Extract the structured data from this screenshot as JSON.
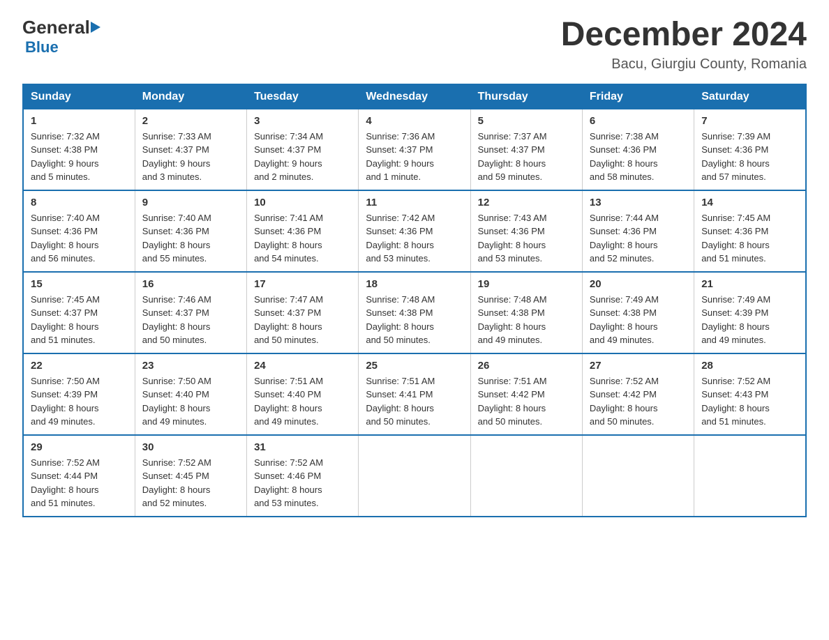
{
  "header": {
    "logo_general": "General",
    "logo_blue": "Blue",
    "title": "December 2024",
    "location": "Bacu, Giurgiu County, Romania"
  },
  "calendar": {
    "days_of_week": [
      "Sunday",
      "Monday",
      "Tuesday",
      "Wednesday",
      "Thursday",
      "Friday",
      "Saturday"
    ],
    "weeks": [
      [
        {
          "day": "1",
          "sunrise": "7:32 AM",
          "sunset": "4:38 PM",
          "daylight": "9 hours and 5 minutes."
        },
        {
          "day": "2",
          "sunrise": "7:33 AM",
          "sunset": "4:37 PM",
          "daylight": "9 hours and 3 minutes."
        },
        {
          "day": "3",
          "sunrise": "7:34 AM",
          "sunset": "4:37 PM",
          "daylight": "9 hours and 2 minutes."
        },
        {
          "day": "4",
          "sunrise": "7:36 AM",
          "sunset": "4:37 PM",
          "daylight": "9 hours and 1 minute."
        },
        {
          "day": "5",
          "sunrise": "7:37 AM",
          "sunset": "4:37 PM",
          "daylight": "8 hours and 59 minutes."
        },
        {
          "day": "6",
          "sunrise": "7:38 AM",
          "sunset": "4:36 PM",
          "daylight": "8 hours and 58 minutes."
        },
        {
          "day": "7",
          "sunrise": "7:39 AM",
          "sunset": "4:36 PM",
          "daylight": "8 hours and 57 minutes."
        }
      ],
      [
        {
          "day": "8",
          "sunrise": "7:40 AM",
          "sunset": "4:36 PM",
          "daylight": "8 hours and 56 minutes."
        },
        {
          "day": "9",
          "sunrise": "7:40 AM",
          "sunset": "4:36 PM",
          "daylight": "8 hours and 55 minutes."
        },
        {
          "day": "10",
          "sunrise": "7:41 AM",
          "sunset": "4:36 PM",
          "daylight": "8 hours and 54 minutes."
        },
        {
          "day": "11",
          "sunrise": "7:42 AM",
          "sunset": "4:36 PM",
          "daylight": "8 hours and 53 minutes."
        },
        {
          "day": "12",
          "sunrise": "7:43 AM",
          "sunset": "4:36 PM",
          "daylight": "8 hours and 53 minutes."
        },
        {
          "day": "13",
          "sunrise": "7:44 AM",
          "sunset": "4:36 PM",
          "daylight": "8 hours and 52 minutes."
        },
        {
          "day": "14",
          "sunrise": "7:45 AM",
          "sunset": "4:36 PM",
          "daylight": "8 hours and 51 minutes."
        }
      ],
      [
        {
          "day": "15",
          "sunrise": "7:45 AM",
          "sunset": "4:37 PM",
          "daylight": "8 hours and 51 minutes."
        },
        {
          "day": "16",
          "sunrise": "7:46 AM",
          "sunset": "4:37 PM",
          "daylight": "8 hours and 50 minutes."
        },
        {
          "day": "17",
          "sunrise": "7:47 AM",
          "sunset": "4:37 PM",
          "daylight": "8 hours and 50 minutes."
        },
        {
          "day": "18",
          "sunrise": "7:48 AM",
          "sunset": "4:38 PM",
          "daylight": "8 hours and 50 minutes."
        },
        {
          "day": "19",
          "sunrise": "7:48 AM",
          "sunset": "4:38 PM",
          "daylight": "8 hours and 49 minutes."
        },
        {
          "day": "20",
          "sunrise": "7:49 AM",
          "sunset": "4:38 PM",
          "daylight": "8 hours and 49 minutes."
        },
        {
          "day": "21",
          "sunrise": "7:49 AM",
          "sunset": "4:39 PM",
          "daylight": "8 hours and 49 minutes."
        }
      ],
      [
        {
          "day": "22",
          "sunrise": "7:50 AM",
          "sunset": "4:39 PM",
          "daylight": "8 hours and 49 minutes."
        },
        {
          "day": "23",
          "sunrise": "7:50 AM",
          "sunset": "4:40 PM",
          "daylight": "8 hours and 49 minutes."
        },
        {
          "day": "24",
          "sunrise": "7:51 AM",
          "sunset": "4:40 PM",
          "daylight": "8 hours and 49 minutes."
        },
        {
          "day": "25",
          "sunrise": "7:51 AM",
          "sunset": "4:41 PM",
          "daylight": "8 hours and 50 minutes."
        },
        {
          "day": "26",
          "sunrise": "7:51 AM",
          "sunset": "4:42 PM",
          "daylight": "8 hours and 50 minutes."
        },
        {
          "day": "27",
          "sunrise": "7:52 AM",
          "sunset": "4:42 PM",
          "daylight": "8 hours and 50 minutes."
        },
        {
          "day": "28",
          "sunrise": "7:52 AM",
          "sunset": "4:43 PM",
          "daylight": "8 hours and 51 minutes."
        }
      ],
      [
        {
          "day": "29",
          "sunrise": "7:52 AM",
          "sunset": "4:44 PM",
          "daylight": "8 hours and 51 minutes."
        },
        {
          "day": "30",
          "sunrise": "7:52 AM",
          "sunset": "4:45 PM",
          "daylight": "8 hours and 52 minutes."
        },
        {
          "day": "31",
          "sunrise": "7:52 AM",
          "sunset": "4:46 PM",
          "daylight": "8 hours and 53 minutes."
        },
        null,
        null,
        null,
        null
      ]
    ],
    "sunrise_label": "Sunrise:",
    "sunset_label": "Sunset:",
    "daylight_label": "Daylight:"
  }
}
